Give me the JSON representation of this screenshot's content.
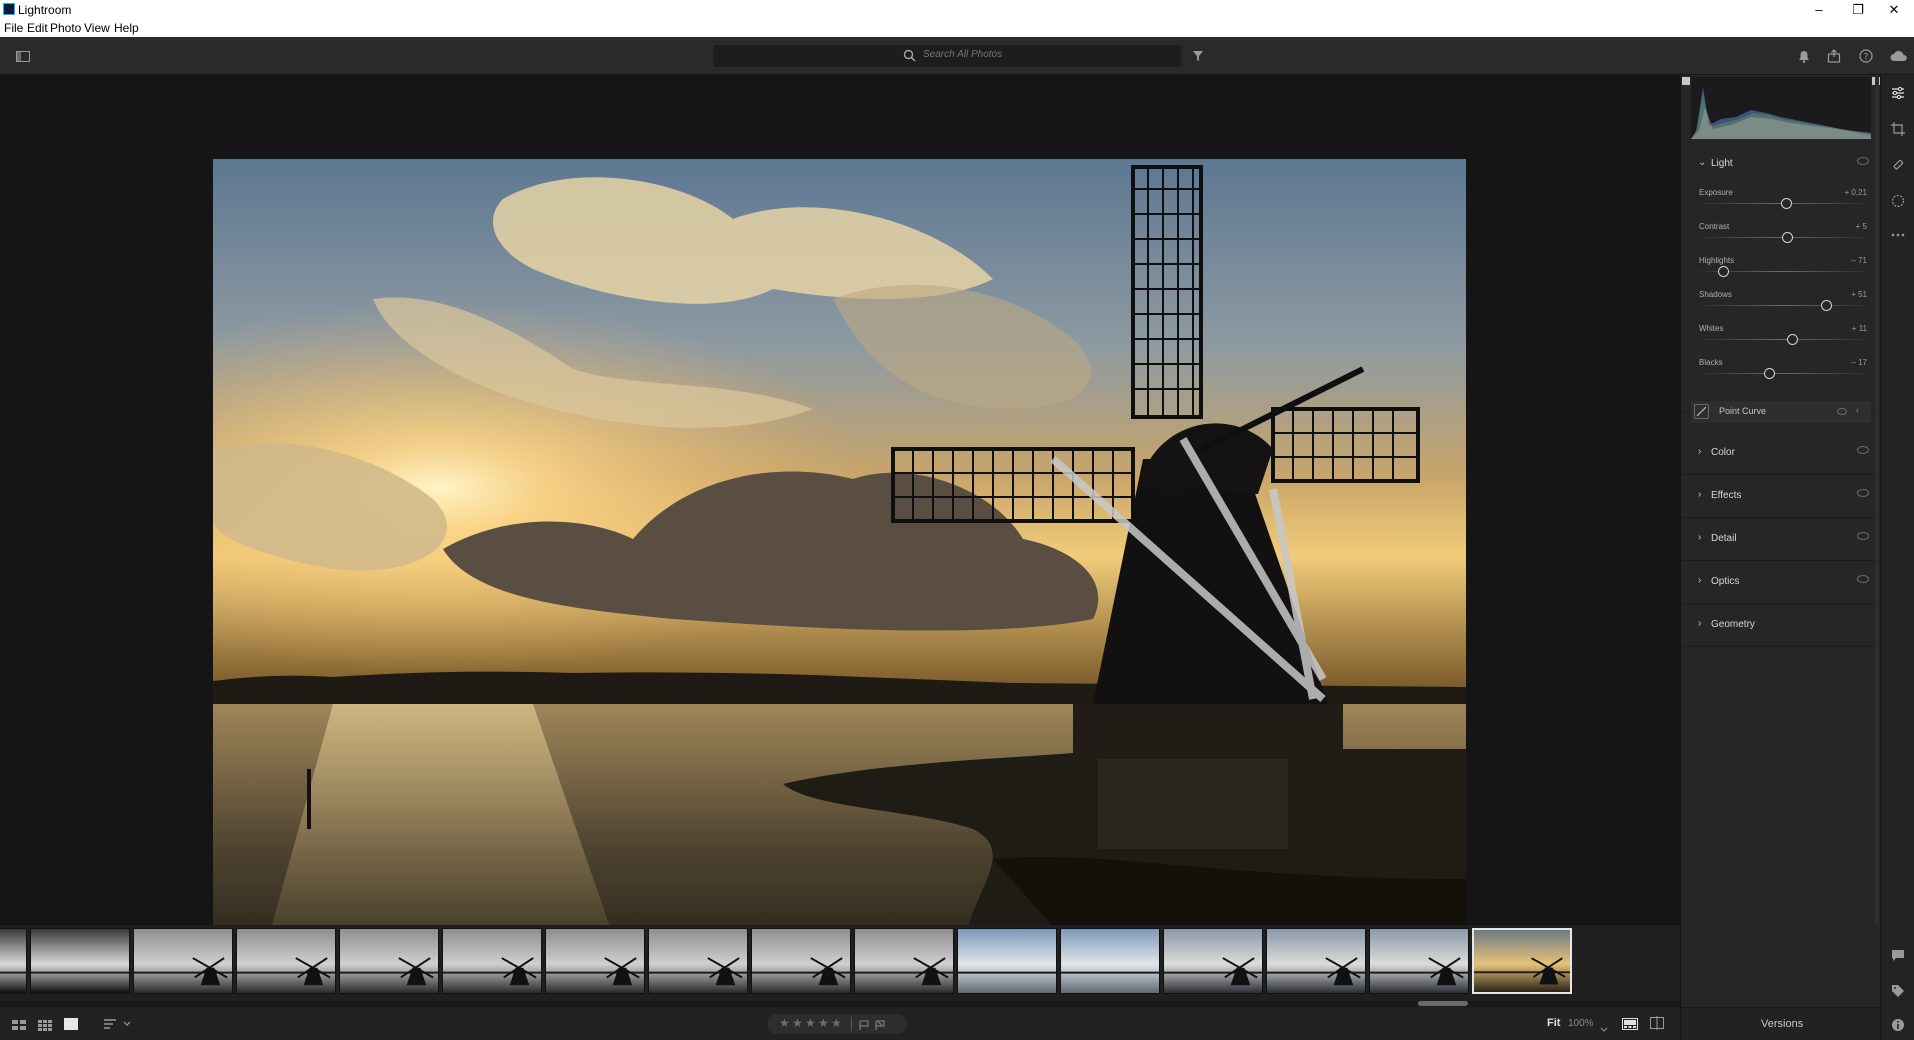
{
  "window": {
    "title": "Lightroom",
    "controls": {
      "minimize": "–",
      "maximize": "❐",
      "close": "✕"
    }
  },
  "menu": [
    "File",
    "Edit",
    "Photo",
    "View",
    "Help"
  ],
  "toolbar": {
    "search_placeholder": "Search All Photos",
    "icons": [
      "panel-toggle-icon",
      "search-icon",
      "filter-icon",
      "bell-icon",
      "share-icon",
      "help-icon",
      "cloud-icon"
    ]
  },
  "edit_panel": {
    "light": {
      "title": "Light",
      "sliders": [
        {
          "label": "Exposure",
          "value": "+ 0,21",
          "position": 0.52
        },
        {
          "label": "Contrast",
          "value": "+ 5",
          "position": 0.525
        },
        {
          "label": "Highlights",
          "value": "– 71",
          "position": 0.145
        },
        {
          "label": "Shadows",
          "value": "+ 51",
          "position": 0.755
        },
        {
          "label": "Whites",
          "value": "+ 11",
          "position": 0.555
        },
        {
          "label": "Blacks",
          "value": "– 17",
          "position": 0.415
        }
      ],
      "point_curve": "Point Curve"
    },
    "sections": [
      "Color",
      "Effects",
      "Detail",
      "Optics",
      "Geometry"
    ]
  },
  "bottom_bar": {
    "view_icons": [
      "grid-large-icon",
      "grid-small-icon",
      "loupe-icon",
      "sort-icon"
    ],
    "stars": [
      "★",
      "★",
      "★",
      "★",
      "★"
    ],
    "fit_label": "Fit",
    "zoom": "100%",
    "versions_label": "Versions"
  },
  "filmstrip": {
    "thumb_count": 16,
    "selected_index": 15,
    "thumb_styles": [
      "dark",
      "dark",
      "mono",
      "mono",
      "mono",
      "mono",
      "mono",
      "mono",
      "mono",
      "mono",
      "sky",
      "sky",
      "mill",
      "mill",
      "mill",
      "gold"
    ]
  },
  "colors": {
    "accent": "#31a8ff",
    "panel_bg": "#262626",
    "stage_bg": "#151515"
  }
}
